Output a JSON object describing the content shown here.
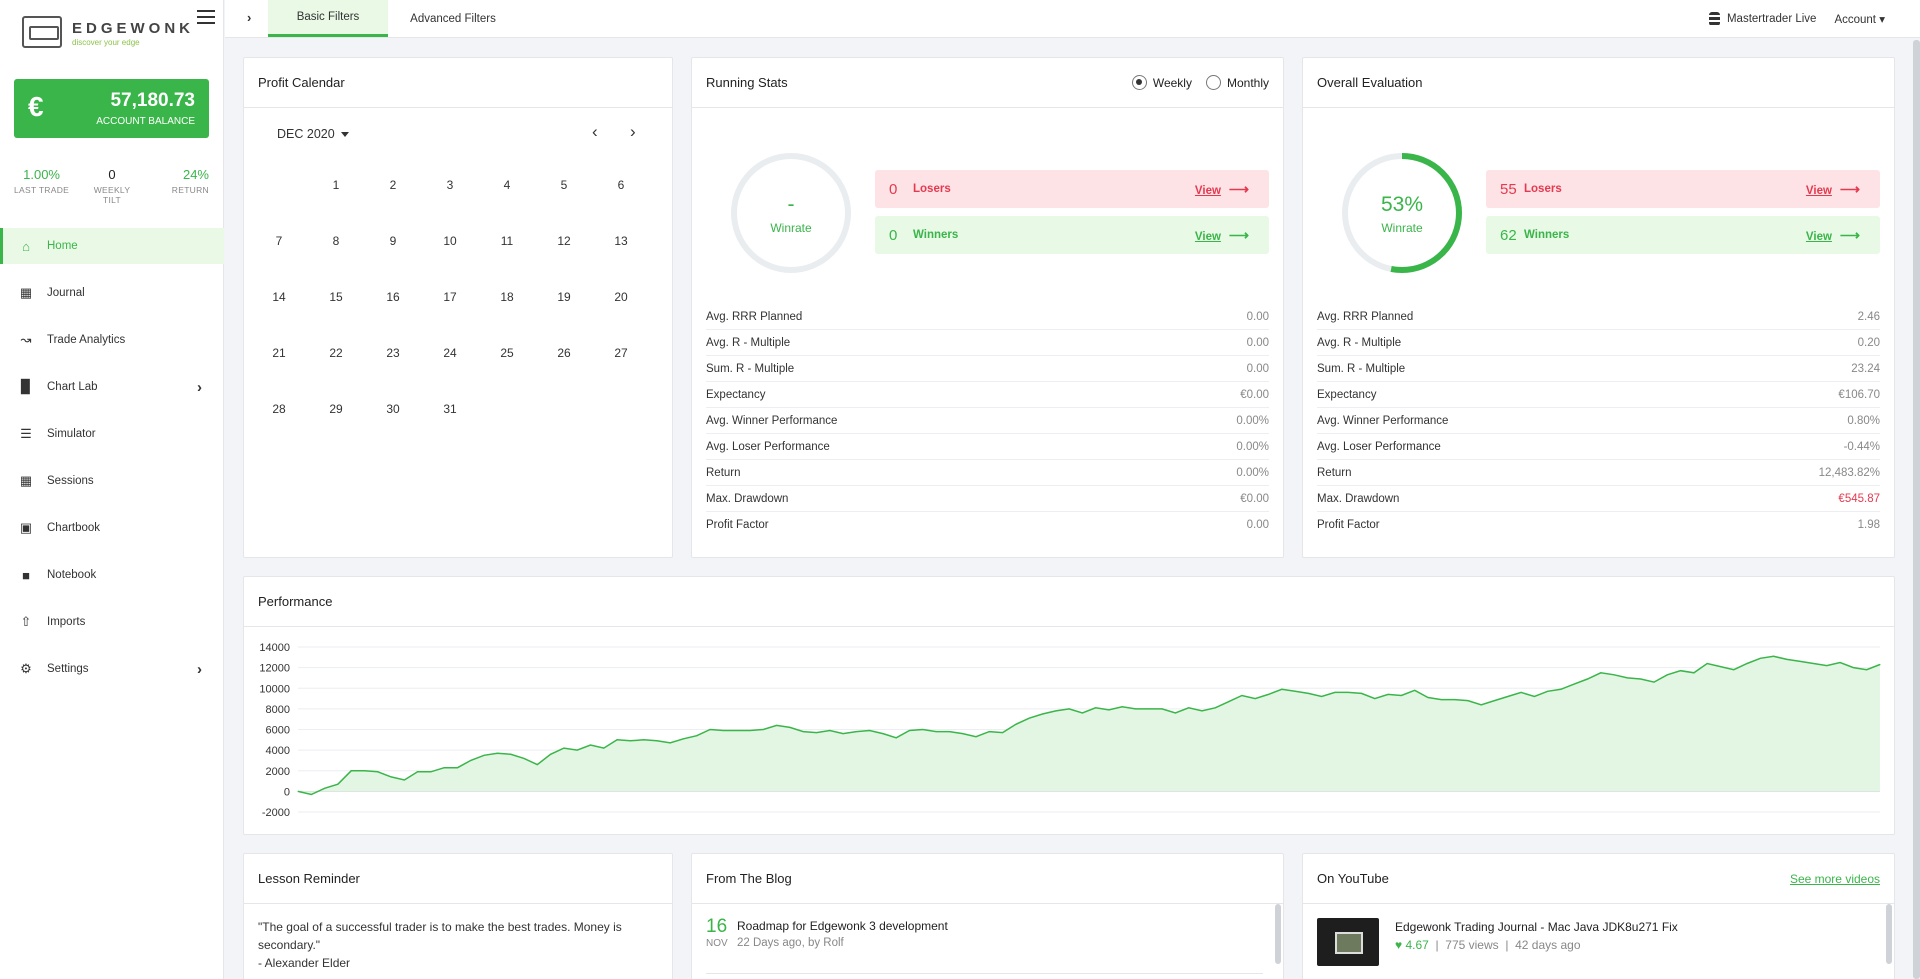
{
  "brand": {
    "name": "EDGEWONK",
    "tagline": "discover your edge"
  },
  "account": {
    "currency_symbol": "€",
    "balance": "57,180.73",
    "balance_label": "ACCOUNT BALANCE",
    "stats": [
      {
        "value": "1.00%",
        "label": "LAST TRADE"
      },
      {
        "value": "0",
        "label": "WEEKLY TILT"
      },
      {
        "value": "24%",
        "label": "RETURN"
      }
    ]
  },
  "nav": [
    {
      "label": "Home",
      "icon": "home-icon",
      "active": true
    },
    {
      "label": "Journal",
      "icon": "calendar-icon"
    },
    {
      "label": "Trade Analytics",
      "icon": "line-chart-icon"
    },
    {
      "label": "Chart Lab",
      "icon": "bar-chart-icon",
      "has_children": true
    },
    {
      "label": "Simulator",
      "icon": "layers-icon"
    },
    {
      "label": "Sessions",
      "icon": "grid-icon"
    },
    {
      "label": "Chartbook",
      "icon": "images-icon"
    },
    {
      "label": "Notebook",
      "icon": "note-icon"
    },
    {
      "label": "Imports",
      "icon": "upload-icon"
    },
    {
      "label": "Settings",
      "icon": "gear-icon",
      "has_children": true
    }
  ],
  "topbar": {
    "tabs": [
      "Basic Filters",
      "Advanced Filters"
    ],
    "active_tab": "Basic Filters",
    "account_name": "Mastertrader Live",
    "account_menu": "Account"
  },
  "calendar": {
    "title": "Profit Calendar",
    "month": "DEC 2020",
    "days": [
      "1",
      "2",
      "3",
      "4",
      "5",
      "6",
      "7",
      "8",
      "9",
      "10",
      "11",
      "12",
      "13",
      "14",
      "15",
      "16",
      "17",
      "18",
      "19",
      "20",
      "21",
      "22",
      "23",
      "24",
      "25",
      "26",
      "27",
      "28",
      "29",
      "30",
      "31"
    ]
  },
  "running": {
    "title": "Running Stats",
    "period_options": [
      "Weekly",
      "Monthly"
    ],
    "selected_period": "Weekly",
    "winrate_value": "-",
    "winrate_label": "Winrate",
    "winrate_fraction": 0,
    "losers_count": "0",
    "losers_label": "Losers",
    "winners_count": "0",
    "winners_label": "Winners",
    "view_label": "View",
    "stats": [
      {
        "label": "Avg. RRR Planned",
        "value": "0.00"
      },
      {
        "label": "Avg. R - Multiple",
        "value": "0.00"
      },
      {
        "label": "Sum. R - Multiple",
        "value": "0.00"
      },
      {
        "label": "Expectancy",
        "value": "€0.00"
      },
      {
        "label": "Avg. Winner Performance",
        "value": "0.00%"
      },
      {
        "label": "Avg. Loser Performance",
        "value": "0.00%"
      },
      {
        "label": "Return",
        "value": "0.00%"
      },
      {
        "label": "Max. Drawdown",
        "value": "€0.00"
      },
      {
        "label": "Profit Factor",
        "value": "0.00"
      }
    ]
  },
  "overall": {
    "title": "Overall Evaluation",
    "winrate_value": "53%",
    "winrate_label": "Winrate",
    "winrate_fraction": 0.53,
    "losers_count": "55",
    "losers_label": "Losers",
    "winners_count": "62",
    "winners_label": "Winners",
    "view_label": "View",
    "stats": [
      {
        "label": "Avg. RRR Planned",
        "value": "2.46"
      },
      {
        "label": "Avg. R - Multiple",
        "value": "0.20"
      },
      {
        "label": "Sum. R - Multiple",
        "value": "23.24"
      },
      {
        "label": "Expectancy",
        "value": "€106.70"
      },
      {
        "label": "Avg. Winner Performance",
        "value": "0.80%"
      },
      {
        "label": "Avg. Loser Performance",
        "value": "-0.44%"
      },
      {
        "label": "Return",
        "value": "12,483.82%"
      },
      {
        "label": "Max. Drawdown",
        "value": "€545.87",
        "negative": true
      },
      {
        "label": "Profit Factor",
        "value": "1.98"
      }
    ]
  },
  "performance": {
    "title": "Performance"
  },
  "chart_data": {
    "type": "area",
    "ylim": [
      -2000,
      14000
    ],
    "yticks": [
      -2000,
      0,
      2000,
      4000,
      6000,
      8000,
      10000,
      12000,
      14000
    ],
    "grid": true,
    "color": "#3ab54a",
    "values": [
      0,
      -300,
      300,
      700,
      2000,
      2000,
      1900,
      1400,
      1100,
      1900,
      1900,
      2300,
      2300,
      3000,
      3500,
      3700,
      3600,
      3200,
      2600,
      3600,
      4200,
      4000,
      4500,
      4200,
      5000,
      4900,
      5000,
      4900,
      4700,
      5100,
      5400,
      6000,
      5900,
      5900,
      5900,
      6000,
      6400,
      6200,
      5800,
      5700,
      5900,
      5600,
      5800,
      5900,
      5600,
      5200,
      5900,
      6000,
      5800,
      5800,
      5600,
      5300,
      5800,
      5700,
      6500,
      7100,
      7500,
      7800,
      8000,
      7600,
      8100,
      7900,
      8200,
      8000,
      8000,
      8000,
      7600,
      8100,
      7800,
      8100,
      8700,
      9300,
      9000,
      9400,
      9900,
      9700,
      9500,
      9200,
      9600,
      9600,
      9500,
      9000,
      9400,
      9300,
      9800,
      9100,
      8900,
      8900,
      8800,
      8400,
      8800,
      9200,
      9600,
      9200,
      9700,
      9900,
      10400,
      10900,
      11500,
      11300,
      11000,
      10900,
      10600,
      11300,
      11700,
      11500,
      12400,
      12100,
      11800,
      12400,
      12900,
      13100,
      12800,
      12600,
      12400,
      12200,
      12500,
      12000,
      11800,
      12300
    ]
  },
  "lesson": {
    "title": "Lesson Reminder",
    "quote": "\"The goal of a successful trader is to make the best trades. Money is secondary.\"",
    "author": "- Alexander Elder"
  },
  "blog": {
    "title": "From The Blog",
    "items": [
      {
        "day": "16",
        "month": "NOV",
        "title": "Roadmap for Edgewonk 3 development",
        "meta": "22 Days ago, by Rolf"
      }
    ]
  },
  "youtube": {
    "title": "On YouTube",
    "see_more": "See more videos",
    "videos": [
      {
        "title": "Edgewonk Trading Journal - Mac Java JDK8u271 Fix",
        "rating": "4.67",
        "views": "775 views",
        "age": "42 days ago"
      }
    ]
  }
}
